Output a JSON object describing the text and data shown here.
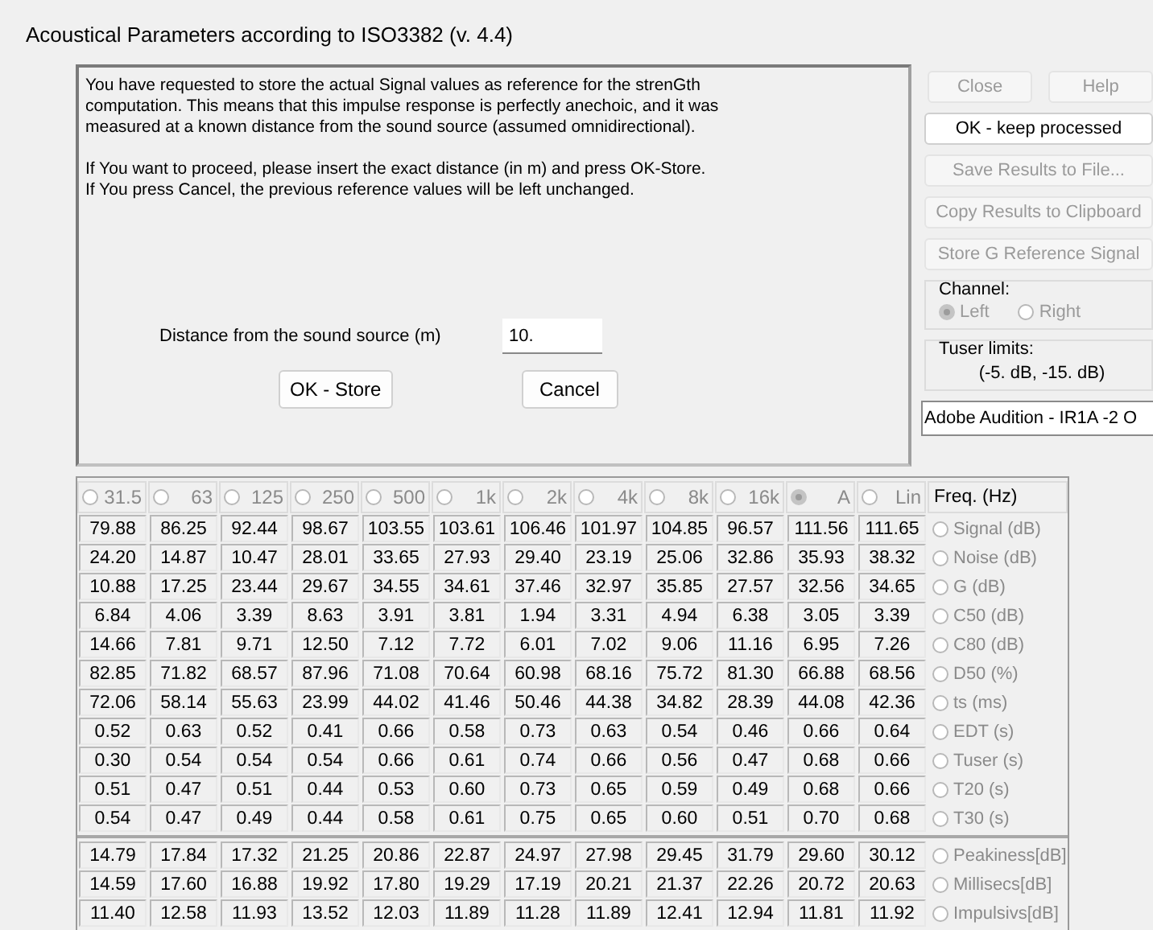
{
  "window": {
    "title": "Acoustical Parameters according to ISO3382 (v. 4.4)"
  },
  "message": {
    "paragraphs": [
      [
        "You have requested to store the actual Signal values as reference for the strenGth",
        "computation. This means that this impulse response is perfectly anechoic, and it was",
        "measured at a known distance from the sound source (assumed omnidirectional)."
      ],
      [
        "If You want to proceed, please insert the exact distance (in m) and press OK-Store.",
        "If You press Cancel, the previous reference values will be left unchanged."
      ]
    ],
    "distance": {
      "label": "Distance from the sound source (m)",
      "value": "10."
    },
    "buttons": [
      {
        "label": "OK - Store"
      },
      {
        "label": "Cancel"
      }
    ]
  },
  "side_panel": {
    "top_buttons": [
      {
        "label": "Close",
        "disabled": true
      },
      {
        "label": "Help",
        "disabled": true
      }
    ],
    "buttons": [
      {
        "label": "OK - keep processed",
        "disabled": false
      },
      {
        "label": "Save Results to File...",
        "disabled": true
      },
      {
        "label": "Copy Results to Clipboard",
        "disabled": true
      },
      {
        "label": "Store G Reference Signal",
        "disabled": true
      }
    ],
    "channel": {
      "title": "Channel:",
      "options": [
        {
          "label": "Left",
          "selected": true
        },
        {
          "label": "Right",
          "selected": false
        }
      ]
    },
    "tuser_limits": {
      "title": "Tuser  limits:",
      "value": "(-5. dB, -15. dB)"
    },
    "source": "Adobe Audition - IR1A -2 O"
  },
  "table": {
    "bands": [
      {
        "label": "31.5",
        "selected": false
      },
      {
        "label": "63",
        "selected": false
      },
      {
        "label": "125",
        "selected": false
      },
      {
        "label": "250",
        "selected": false
      },
      {
        "label": "500",
        "selected": false
      },
      {
        "label": "1k",
        "selected": false
      },
      {
        "label": "2k",
        "selected": false
      },
      {
        "label": "4k",
        "selected": false
      },
      {
        "label": "8k",
        "selected": false
      },
      {
        "label": "16k",
        "selected": false
      },
      {
        "label": "A",
        "selected": true
      },
      {
        "label": "Lin",
        "selected": false
      }
    ],
    "freq_header": "Freq. (Hz)",
    "groups": [
      {
        "rows": [
          {
            "label": "Signal (dB)",
            "selected": false,
            "values": [
              "79.88",
              "86.25",
              "92.44",
              "98.67",
              "103.55",
              "103.61",
              "106.46",
              "101.97",
              "104.85",
              "96.57",
              "111.56",
              "111.65"
            ]
          },
          {
            "label": "Noise (dB)",
            "selected": false,
            "values": [
              "24.20",
              "14.87",
              "10.47",
              "28.01",
              "33.65",
              "27.93",
              "29.40",
              "23.19",
              "25.06",
              "32.86",
              "35.93",
              "38.32"
            ]
          },
          {
            "label": "G (dB)",
            "selected": false,
            "values": [
              "10.88",
              "17.25",
              "23.44",
              "29.67",
              "34.55",
              "34.61",
              "37.46",
              "32.97",
              "35.85",
              "27.57",
              "32.56",
              "34.65"
            ]
          },
          {
            "label": "C50 (dB)",
            "selected": false,
            "values": [
              "6.84",
              "4.06",
              "3.39",
              "8.63",
              "3.91",
              "3.81",
              "1.94",
              "3.31",
              "4.94",
              "6.38",
              "3.05",
              "3.39"
            ]
          },
          {
            "label": "C80 (dB)",
            "selected": false,
            "values": [
              "14.66",
              "7.81",
              "9.71",
              "12.50",
              "7.12",
              "7.72",
              "6.01",
              "7.02",
              "9.06",
              "11.16",
              "6.95",
              "7.26"
            ]
          },
          {
            "label": "D50 (%)",
            "selected": false,
            "values": [
              "82.85",
              "71.82",
              "68.57",
              "87.96",
              "71.08",
              "70.64",
              "60.98",
              "68.16",
              "75.72",
              "81.30",
              "66.88",
              "68.56"
            ]
          },
          {
            "label": "ts (ms)",
            "selected": false,
            "values": [
              "72.06",
              "58.14",
              "55.63",
              "23.99",
              "44.02",
              "41.46",
              "50.46",
              "44.38",
              "34.82",
              "28.39",
              "44.08",
              "42.36"
            ]
          },
          {
            "label": "EDT (s)",
            "selected": false,
            "values": [
              "0.52",
              "0.63",
              "0.52",
              "0.41",
              "0.66",
              "0.58",
              "0.73",
              "0.63",
              "0.54",
              "0.46",
              "0.66",
              "0.64"
            ]
          },
          {
            "label": "Tuser (s)",
            "selected": false,
            "values": [
              "0.30",
              "0.54",
              "0.54",
              "0.54",
              "0.66",
              "0.61",
              "0.74",
              "0.66",
              "0.56",
              "0.47",
              "0.68",
              "0.66"
            ]
          },
          {
            "label": "T20 (s)",
            "selected": false,
            "values": [
              "0.51",
              "0.47",
              "0.51",
              "0.44",
              "0.53",
              "0.60",
              "0.73",
              "0.65",
              "0.59",
              "0.49",
              "0.68",
              "0.66"
            ]
          },
          {
            "label": "T30 (s)",
            "selected": false,
            "values": [
              "0.54",
              "0.47",
              "0.49",
              "0.44",
              "0.58",
              "0.61",
              "0.75",
              "0.65",
              "0.60",
              "0.51",
              "0.70",
              "0.68"
            ]
          }
        ]
      },
      {
        "rows": [
          {
            "label": "Peakiness[dB]",
            "selected": false,
            "values": [
              "14.79",
              "17.84",
              "17.32",
              "21.25",
              "20.86",
              "22.87",
              "24.97",
              "27.98",
              "29.45",
              "31.79",
              "29.60",
              "30.12"
            ]
          },
          {
            "label": "Millisecs[dB]",
            "selected": false,
            "values": [
              "14.59",
              "17.60",
              "16.88",
              "19.92",
              "17.80",
              "19.29",
              "17.19",
              "20.21",
              "21.37",
              "22.26",
              "20.72",
              "20.63"
            ]
          },
          {
            "label": "Impulsivs[dB]",
            "selected": false,
            "values": [
              "11.40",
              "12.58",
              "11.93",
              "13.52",
              "12.03",
              "11.89",
              "11.28",
              "11.89",
              "12.41",
              "12.94",
              "11.81",
              "11.92"
            ]
          }
        ]
      }
    ]
  }
}
